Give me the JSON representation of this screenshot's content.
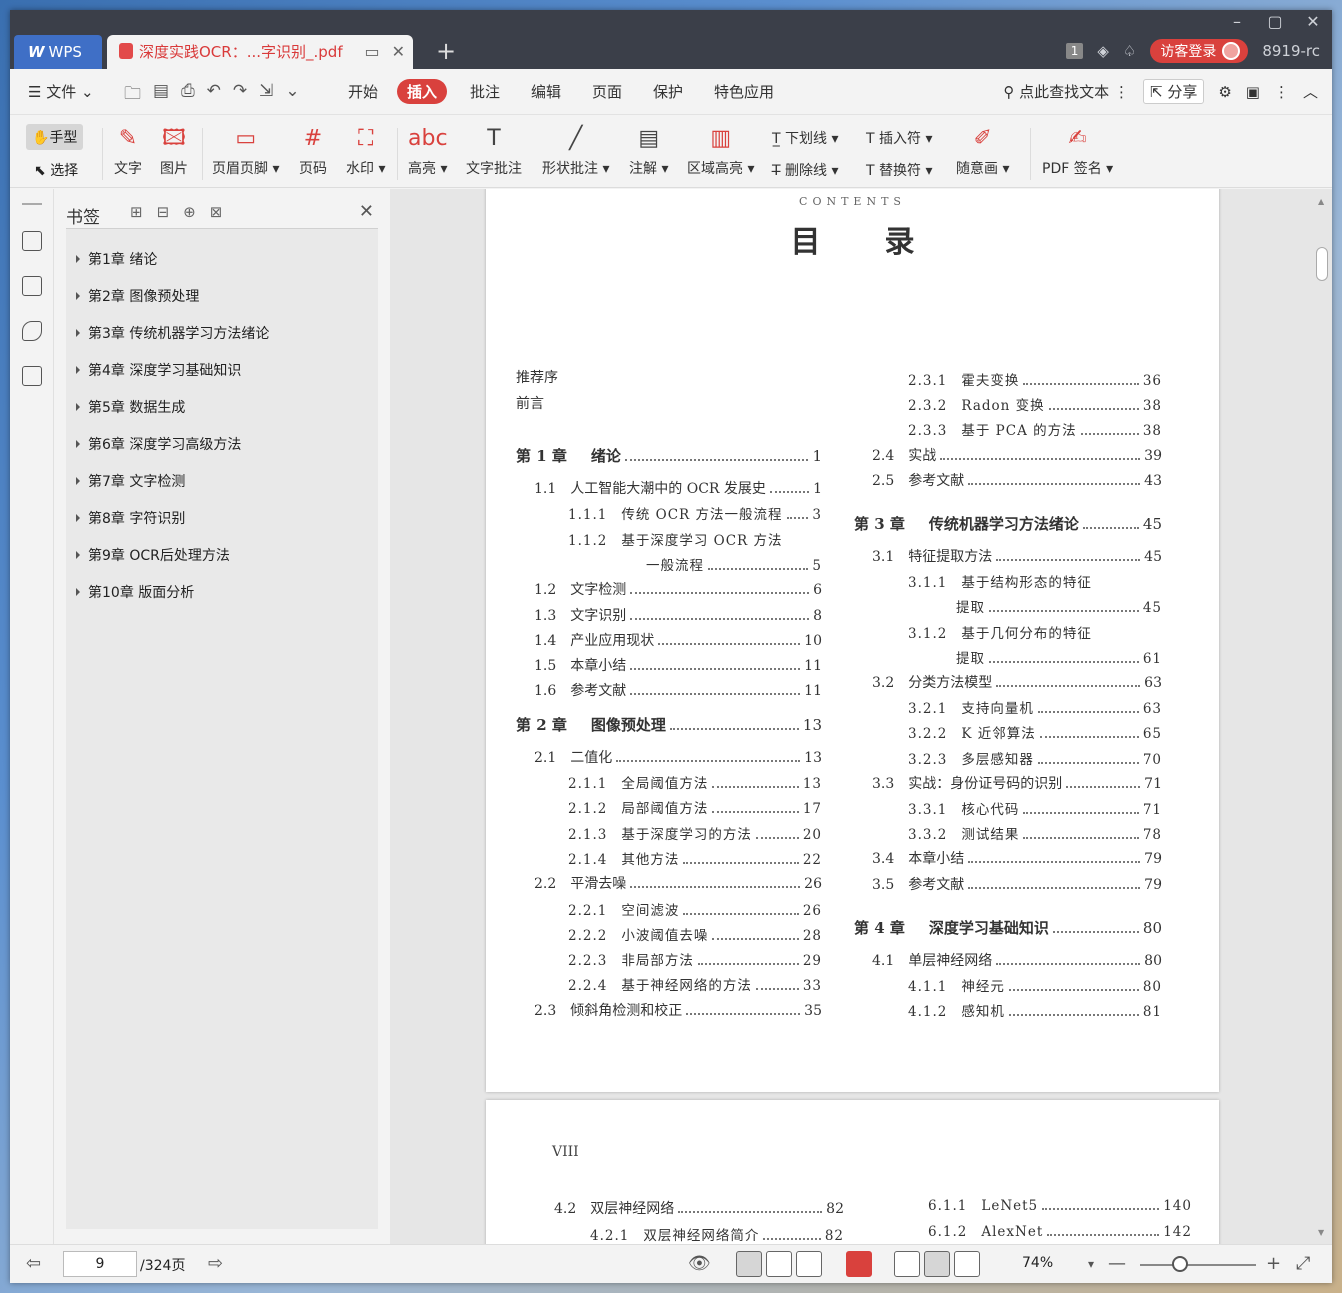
{
  "titlebar": {
    "app_tab": "WPS",
    "doc_tab": "深度实践OCR：...字识别_.pdf",
    "badge": "1",
    "login": "访客登录",
    "user": "8919-rc"
  },
  "menubar": {
    "file": "文件",
    "items": [
      "开始",
      "插入",
      "批注",
      "编辑",
      "页面",
      "保护",
      "特色应用"
    ],
    "active": "插入",
    "search": "点此查找文本",
    "share": "分享"
  },
  "ribbon": {
    "hand": "手型",
    "select": "选择",
    "text": "文字",
    "image": "图片",
    "header_footer": "页眉页脚",
    "page_num": "页码",
    "watermark": "水印",
    "highlight": "高亮",
    "text_comment": "文字批注",
    "shape_comment": "形状批注",
    "annotation": "注解",
    "area_highlight": "区域高亮",
    "underline": "下划线",
    "strikethrough": "删除线",
    "insert_mark": "插入符",
    "replace_mark": "替换符",
    "freehand": "随意画",
    "pdf_sign": "PDF 签名"
  },
  "bookmark": {
    "title": "书签",
    "items": [
      "第1章 绪论",
      "第2章 图像预处理",
      "第3章 传统机器学习方法绪论",
      "第4章 深度学习基础知识",
      "第5章 数据生成",
      "第6章 深度学习高级方法",
      "第7章 文字检测",
      "第8章 字符识别",
      "第9章 OCR后处理方法",
      "第10章 版面分析"
    ]
  },
  "toc": {
    "contents_en": "CONTENTS",
    "title": "目录",
    "preface1": "推荐序",
    "preface2": "前言",
    "left": [
      {
        "n": "第 1 章",
        "t": "绪论",
        "p": "1",
        "k": "ch"
      },
      {
        "n": "1.1",
        "t": "人工智能大潮中的 OCR 发展史",
        "p": "1",
        "k": "sec"
      },
      {
        "n": "1.1.1",
        "t": "传统 OCR 方法一般流程",
        "p": "3",
        "k": "sub"
      },
      {
        "n": "1.1.2",
        "t": "基于深度学习 OCR 方法",
        "p": "",
        "k": "sub"
      },
      {
        "n": "",
        "t": "一般流程",
        "p": "5",
        "k": "cont"
      },
      {
        "n": "1.2",
        "t": "文字检测",
        "p": "6",
        "k": "sec"
      },
      {
        "n": "1.3",
        "t": "文字识别",
        "p": "8",
        "k": "sec"
      },
      {
        "n": "1.4",
        "t": "产业应用现状",
        "p": "10",
        "k": "sec"
      },
      {
        "n": "1.5",
        "t": "本章小结",
        "p": "11",
        "k": "sec"
      },
      {
        "n": "1.6",
        "t": "参考文献",
        "p": "11",
        "k": "sec"
      },
      {
        "n": "第 2 章",
        "t": "图像预处理",
        "p": "13",
        "k": "ch"
      },
      {
        "n": "2.1",
        "t": "二值化",
        "p": "13",
        "k": "sec"
      },
      {
        "n": "2.1.1",
        "t": "全局阈值方法",
        "p": "13",
        "k": "sub"
      },
      {
        "n": "2.1.2",
        "t": "局部阈值方法",
        "p": "17",
        "k": "sub"
      },
      {
        "n": "2.1.3",
        "t": "基于深度学习的方法",
        "p": "20",
        "k": "sub"
      },
      {
        "n": "2.1.4",
        "t": "其他方法",
        "p": "22",
        "k": "sub"
      },
      {
        "n": "2.2",
        "t": "平滑去噪",
        "p": "26",
        "k": "sec"
      },
      {
        "n": "2.2.1",
        "t": "空间滤波",
        "p": "26",
        "k": "sub"
      },
      {
        "n": "2.2.2",
        "t": "小波阈值去噪",
        "p": "28",
        "k": "sub"
      },
      {
        "n": "2.2.3",
        "t": "非局部方法",
        "p": "29",
        "k": "sub"
      },
      {
        "n": "2.2.4",
        "t": "基于神经网络的方法",
        "p": "33",
        "k": "sub"
      },
      {
        "n": "2.3",
        "t": "倾斜角检测和校正",
        "p": "35",
        "k": "sec"
      }
    ],
    "right": [
      {
        "n": "2.3.1",
        "t": "霍夫变换",
        "p": "36",
        "k": "sub"
      },
      {
        "n": "2.3.2",
        "t": "Radon 变换",
        "p": "38",
        "k": "sub"
      },
      {
        "n": "2.3.3",
        "t": "基于 PCA 的方法",
        "p": "38",
        "k": "sub"
      },
      {
        "n": "2.4",
        "t": "实战",
        "p": "39",
        "k": "sec"
      },
      {
        "n": "2.5",
        "t": "参考文献",
        "p": "43",
        "k": "sec"
      },
      {
        "n": "第 3 章",
        "t": "传统机器学习方法绪论",
        "p": "45",
        "k": "ch"
      },
      {
        "n": "3.1",
        "t": "特征提取方法",
        "p": "45",
        "k": "sec"
      },
      {
        "n": "3.1.1",
        "t": "基于结构形态的特征",
        "p": "",
        "k": "sub"
      },
      {
        "n": "",
        "t": "提取",
        "p": "45",
        "k": "cont"
      },
      {
        "n": "3.1.2",
        "t": "基于几何分布的特征",
        "p": "",
        "k": "sub"
      },
      {
        "n": "",
        "t": "提取",
        "p": "61",
        "k": "cont"
      },
      {
        "n": "3.2",
        "t": "分类方法模型",
        "p": "63",
        "k": "sec"
      },
      {
        "n": "3.2.1",
        "t": "支持向量机",
        "p": "63",
        "k": "sub"
      },
      {
        "n": "3.2.2",
        "t": "K 近邻算法",
        "p": "65",
        "k": "sub"
      },
      {
        "n": "3.2.3",
        "t": "多层感知器",
        "p": "70",
        "k": "sub"
      },
      {
        "n": "3.3",
        "t": "实战：身份证号码的识别",
        "p": "71",
        "k": "sec"
      },
      {
        "n": "3.3.1",
        "t": "核心代码",
        "p": "71",
        "k": "sub"
      },
      {
        "n": "3.3.2",
        "t": "测试结果",
        "p": "78",
        "k": "sub"
      },
      {
        "n": "3.4",
        "t": "本章小结",
        "p": "79",
        "k": "sec"
      },
      {
        "n": "3.5",
        "t": "参考文献",
        "p": "79",
        "k": "sec"
      },
      {
        "n": "第 4 章",
        "t": "深度学习基础知识",
        "p": "80",
        "k": "ch"
      },
      {
        "n": "4.1",
        "t": "单层神经网络",
        "p": "80",
        "k": "sec"
      },
      {
        "n": "4.1.1",
        "t": "神经元",
        "p": "80",
        "k": "sub"
      },
      {
        "n": "4.1.2",
        "t": "感知机",
        "p": "81",
        "k": "sub"
      }
    ],
    "page2_label": "VIII",
    "page2_left": [
      {
        "n": "4.2",
        "t": "双层神经网络",
        "p": "82",
        "k": "sec"
      },
      {
        "n": "4.2.1",
        "t": "双层神经网络简介",
        "p": "82",
        "k": "sub"
      }
    ],
    "page2_right": [
      {
        "n": "6.1.1",
        "t": "LeNet5",
        "p": "140",
        "k": "sub"
      },
      {
        "n": "6.1.2",
        "t": "AlexNet",
        "p": "142",
        "k": "sub"
      }
    ]
  },
  "statusbar": {
    "page": "9",
    "total": "/324页",
    "zoom": "74%"
  }
}
